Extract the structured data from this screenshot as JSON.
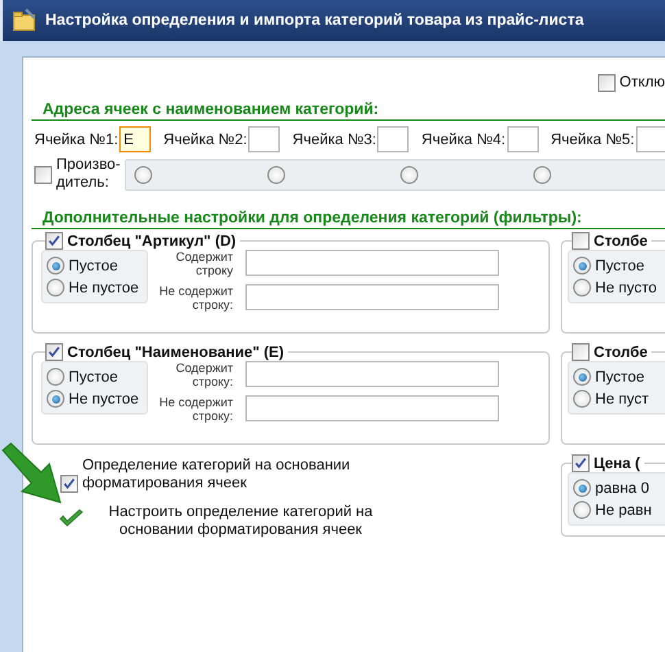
{
  "window": {
    "title": "Настройка определения и импорта категорий товара из прайс-листа"
  },
  "disable_option": {
    "label": "Отклю",
    "checked": false
  },
  "cell_section": {
    "heading": "Адреса ячеек с наименованием категорий:",
    "cells": [
      {
        "label": "Ячейка №1:",
        "value": "E",
        "focused": true
      },
      {
        "label": "Ячейка №2:",
        "focused": false
      },
      {
        "label": "Ячейка №3:",
        "focused": false
      },
      {
        "label": "Ячейка №4:",
        "focused": false
      },
      {
        "label": "Ячейка №5:",
        "focused": false
      }
    ],
    "producer": {
      "label": "Произво-дитель:",
      "checked": false,
      "options": [
        {
          "selected": false
        },
        {
          "selected": false
        },
        {
          "selected": false
        },
        {
          "selected": false
        }
      ]
    }
  },
  "filter_section": {
    "heading": "Дополнительные настройки для определения категорий (фильтры):",
    "groups": [
      {
        "title": "Столбец \"Артикул\" (D)",
        "checked": true,
        "options": [
          {
            "label": "Пустое",
            "selected": true
          },
          {
            "label": "Не пустое",
            "selected": false
          }
        ],
        "fields": [
          {
            "label": "Содержит строку"
          },
          {
            "label": "Не содержит строку:"
          }
        ]
      },
      {
        "title": "Столбец \"Наименование\" (E)",
        "checked": true,
        "options": [
          {
            "label": "Пустое",
            "selected": false
          },
          {
            "label": "Не пустое",
            "selected": true
          }
        ],
        "fields": [
          {
            "label": "Содержит строку:"
          },
          {
            "label": "Не содержит строку:"
          }
        ]
      }
    ],
    "side_groups": [
      {
        "title": "Столбе",
        "checked": false,
        "options": [
          {
            "label": "Пустое",
            "selected": true
          },
          {
            "label": "Не пусто",
            "selected": false
          }
        ]
      },
      {
        "title": "Столбе",
        "checked": false,
        "options": [
          {
            "label": "Пустое",
            "selected": true
          },
          {
            "label": "Не пуст",
            "selected": false
          }
        ]
      },
      {
        "title": "Цена (",
        "checked": true,
        "options": [
          {
            "label": "равна 0",
            "selected": true
          },
          {
            "label": "Не равн",
            "selected": false
          }
        ]
      }
    ]
  },
  "format_option": {
    "label": "Определение категорий на основании форматирования ячеек",
    "checked": true
  },
  "format_link": {
    "label": "Настроить определение категорий на основании форматирования ячеек"
  }
}
